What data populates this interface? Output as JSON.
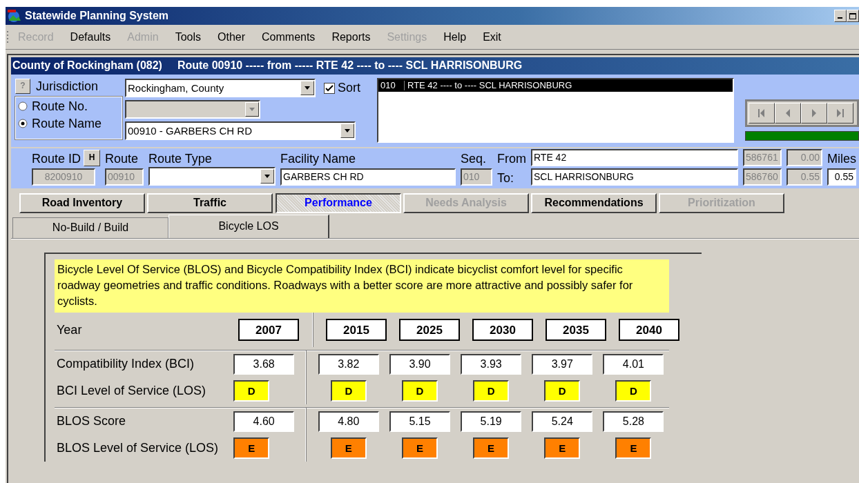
{
  "window": {
    "title": "Statewide Planning System"
  },
  "menu": [
    {
      "label": "Record",
      "disabled": true
    },
    {
      "label": "Defaults",
      "disabled": false
    },
    {
      "label": "Admin",
      "disabled": true
    },
    {
      "label": "Tools",
      "disabled": false
    },
    {
      "label": "Other",
      "disabled": false
    },
    {
      "label": "Comments",
      "disabled": false
    },
    {
      "label": "Reports",
      "disabled": false
    },
    {
      "label": "Settings",
      "disabled": true
    },
    {
      "label": "Help",
      "disabled": false
    },
    {
      "label": "Exit",
      "disabled": false
    }
  ],
  "header": {
    "county": "County of Rockingham (082)",
    "route": "Route 00910 ----- from ----- RTE 42 ---- to ---- SCL HARRISONBURG"
  },
  "selector": {
    "help_button": "?",
    "jurisdiction_label": "Jurisdiction",
    "jurisdiction": "Rockingham, County",
    "sort": {
      "label": "Sort",
      "checked": true
    },
    "route_options": [
      {
        "label": "Route No.",
        "selected": false
      },
      {
        "label": "Route Name",
        "selected": true
      }
    ],
    "route_no": {
      "disabled": true
    },
    "route_name": "00910 - GARBERS CH RD",
    "segments": [
      {
        "seq": "010",
        "text": "RTE 42 ---- to ---- SCL HARRISONBURG",
        "selected": true
      }
    ],
    "progress": {
      "level": 1
    }
  },
  "route": {
    "route_id_label": "Route ID",
    "history_button": "H",
    "route_id": "8200910",
    "route_label": "Route",
    "route": "00910",
    "route_type_label": "Route Type",
    "facility_label": "Facility Name",
    "facility": "GARBERS CH RD",
    "seq_label": "Seq.",
    "seq": "010",
    "from_label": "From",
    "to_label": "To:",
    "from": "RTE 42",
    "to": "SCL HARRISONBURG",
    "from_node": "586761",
    "to_node": "586760",
    "from_mile": "0.00",
    "to_mile": "0.55",
    "miles_label": "Miles",
    "length": "0.55"
  },
  "tabs": [
    {
      "label": "Road Inventory",
      "selected": false,
      "disabled": false
    },
    {
      "label": "Traffic",
      "selected": false,
      "disabled": false
    },
    {
      "label": "Performance",
      "selected": true,
      "disabled": false
    },
    {
      "label": "Needs Analysis",
      "selected": false,
      "disabled": true
    },
    {
      "label": "Recommendations",
      "selected": false,
      "disabled": false
    },
    {
      "label": "Prioritization",
      "selected": false,
      "disabled": true
    }
  ],
  "subtabs": [
    {
      "label": "No-Build / Build",
      "selected": false
    },
    {
      "label": "Bicycle LOS",
      "selected": true
    }
  ],
  "note": "Bicycle Level Of Service (BLOS) and Bicycle Compatibility Index (BCI) indicate bicyclist comfort level for specific roadway geometries and traffic conditions. Roadways with a better score are more attractive and possibly safer for cyclists.",
  "table": {
    "year_label": "Year",
    "years": [
      "2007",
      "2015",
      "2025",
      "2030",
      "2035",
      "2040"
    ],
    "groups": [
      [
        {
          "label": "Compatibility Index (BCI)",
          "kind": "value",
          "cells": [
            {
              "text": "3.68"
            },
            {
              "text": "3.82"
            },
            {
              "text": "3.90"
            },
            {
              "text": "3.93"
            },
            {
              "text": "3.97"
            },
            {
              "text": "4.01"
            }
          ]
        },
        {
          "label": "BCI Level of Service (LOS)",
          "kind": "grade",
          "cells": [
            {
              "text": "D",
              "color": "#ffff00"
            },
            {
              "text": "D",
              "color": "#ffff00"
            },
            {
              "text": "D",
              "color": "#ffff00"
            },
            {
              "text": "D",
              "color": "#ffff00"
            },
            {
              "text": "D",
              "color": "#ffff00"
            },
            {
              "text": "D",
              "color": "#ffff00"
            }
          ]
        }
      ],
      [
        {
          "label": "BLOS Score",
          "kind": "value",
          "cells": [
            {
              "text": "4.60"
            },
            {
              "text": "4.80"
            },
            {
              "text": "5.15"
            },
            {
              "text": "5.19"
            },
            {
              "text": "5.24"
            },
            {
              "text": "5.28"
            }
          ]
        },
        {
          "label": "BLOS Level of Service (LOS)",
          "kind": "grade",
          "cells": [
            {
              "text": "E",
              "color": "#ff8000"
            },
            {
              "text": "E",
              "color": "#ff8000"
            },
            {
              "text": "E",
              "color": "#ff8000"
            },
            {
              "text": "E",
              "color": "#ff8000"
            },
            {
              "text": "E",
              "color": "#ff8000"
            },
            {
              "text": "E",
              "color": "#ff8000"
            }
          ]
        }
      ]
    ]
  }
}
